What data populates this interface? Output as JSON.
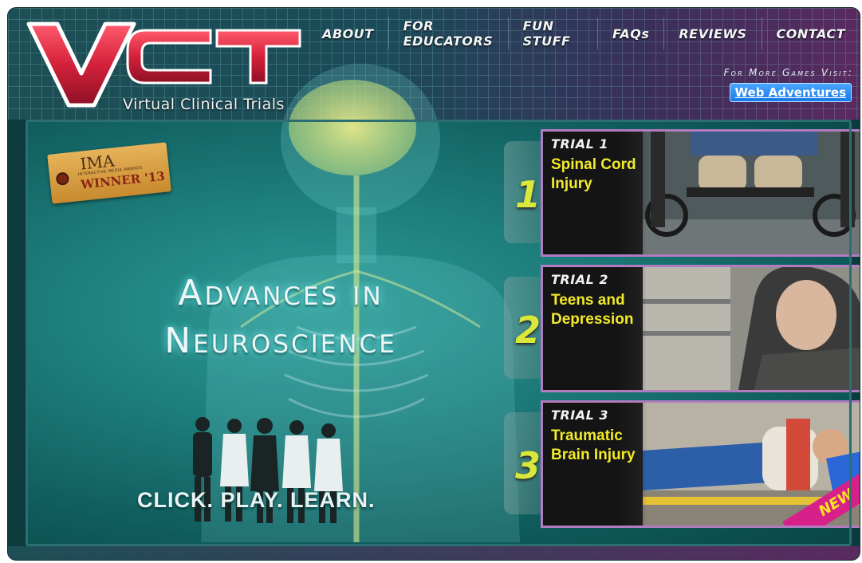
{
  "header": {
    "logo_letters": "VCT",
    "logo_subtitle": "Virtual Clinical Trials",
    "nav": [
      "ABOUT",
      "FOR EDUCATORS",
      "FUN STUFF",
      "FAQs",
      "REVIEWS",
      "CONTACT"
    ],
    "more_games_text": "For More Games Visit:",
    "web_adventures_link": "Web Adventures"
  },
  "hero": {
    "badge_ima": "IMA",
    "badge_small": "INTERACTIVE MEDIA AWARDS",
    "badge_winner": "WINNER '13",
    "headline_line1": "Advances in",
    "headline_line2": "Neuroscience",
    "tagline": "CLICK. PLAY. LEARN."
  },
  "trials": [
    {
      "number": "1",
      "title": "TRIAL 1",
      "name": "Spinal Cord Injury"
    },
    {
      "number": "2",
      "title": "TRIAL 2",
      "name": "Teens and Depression"
    },
    {
      "number": "3",
      "title": "TRIAL 3",
      "name": "Traumatic Brain Injury",
      "badge": "NEW"
    }
  ],
  "colors": {
    "accent_yellow": "#f2ea2a",
    "logo_red": "#d4213b",
    "link_blue": "#1778e8"
  }
}
